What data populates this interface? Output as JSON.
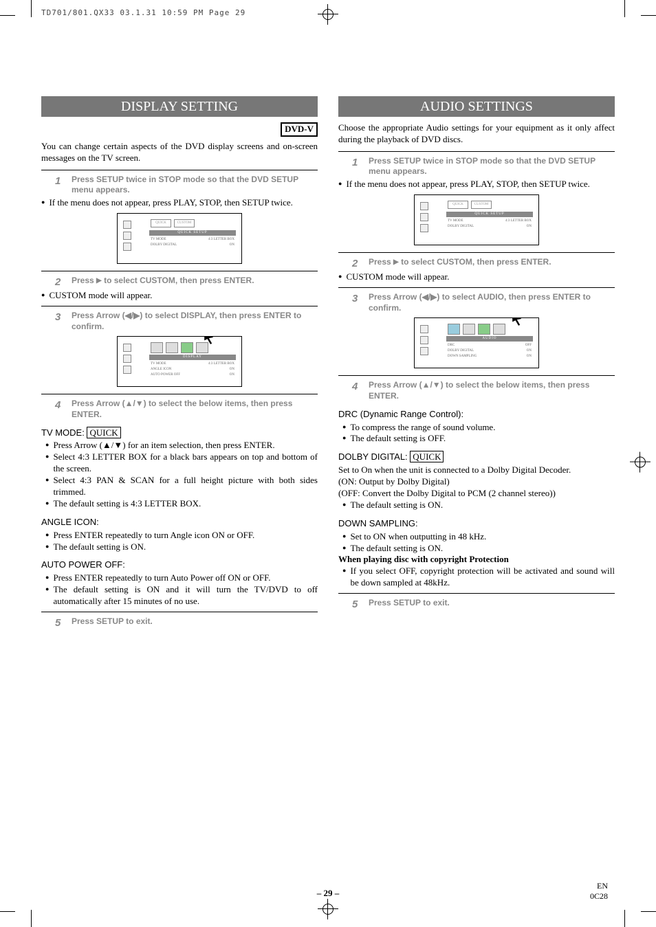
{
  "print_header": "TD701/801.QX33  03.1.31 10:59 PM  Page 29",
  "left": {
    "title": "DISPLAY SETTING",
    "badge": "DVD-V",
    "intro": "You can change certain aspects of the DVD display screens and on-screen messages on the TV screen.",
    "step1_num": "1",
    "step1": "Press SETUP twice in STOP mode so that the DVD SETUP menu appears.",
    "bullet1": "If the menu does not appear, press PLAY, STOP, then SETUP twice.",
    "screen1": {
      "tab1": "QUICK",
      "tab2": "CUSTOM",
      "bar": "QUICK SETUP",
      "row1a": "TV MODE",
      "row1b": "4:3 LETTER BOX",
      "row2a": "DOLBY DIGITAL",
      "row2b": "ON"
    },
    "step2_num": "2",
    "step2_a": "Press ",
    "step2_b": " to select CUSTOM, then press ENTER.",
    "bullet2": "CUSTOM mode will appear.",
    "step3_num": "3",
    "step3": "Press Arrow (◀/▶) to select DISPLAY, then press ENTER to confirm.",
    "screen2": {
      "bar": "DISPLAY",
      "row1a": "TV MODE",
      "row1b": "4:3 LETTER BOX",
      "row2a": "ANGLE ICON",
      "row2b": "ON",
      "row3a": "AUTO POWER OFF",
      "row3b": "ON"
    },
    "step4_num": "4",
    "step4": "Press Arrow (▲/▼) to select the below items, then press ENTER.",
    "tvmode_label": "TV MODE:",
    "tvmode_quick": "QUICK",
    "tvmode_b1": "Press Arrow (▲/▼) for an item selection, then press ENTER.",
    "tvmode_b2": "Select 4:3 LETTER BOX for a black bars appears on top and bottom of the screen.",
    "tvmode_b3": "Select 4:3 PAN & SCAN for a full height picture with both sides trimmed.",
    "tvmode_b4": "The default setting is 4:3 LETTER BOX.",
    "angle_label": "ANGLE ICON:",
    "angle_b1": "Press ENTER repeatedly to turn Angle icon ON or OFF.",
    "angle_b2": "The default setting is ON.",
    "apo_label": "AUTO POWER OFF:",
    "apo_b1": "Press ENTER repeatedly to turn Auto Power off ON or OFF.",
    "apo_b2": "The default setting is ON and it will turn the TV/DVD to off automatically after 15 minutes of no use.",
    "step5_num": "5",
    "step5": "Press SETUP to exit."
  },
  "right": {
    "title": "AUDIO SETTINGS",
    "intro": "Choose the appropriate Audio settings for your equipment as it only affect during the playback of DVD discs.",
    "step1_num": "1",
    "step1": "Press SETUP twice in STOP mode so that the DVD SETUP menu appears.",
    "bullet1": "If the menu does not appear, press PLAY, STOP, then SETUP twice.",
    "screen1": {
      "tab1": "QUICK",
      "tab2": "CUSTOM",
      "bar": "QUICK SETUP",
      "row1a": "TV MODE",
      "row1b": "4:3 LETTER BOX",
      "row2a": "DOLBY DIGITAL",
      "row2b": "ON"
    },
    "step2_num": "2",
    "step2_a": "Press ",
    "step2_b": " to select CUSTOM, then press ENTER.",
    "bullet2": "CUSTOM mode will appear.",
    "step3_num": "3",
    "step3": "Press Arrow (◀/▶) to select AUDIO, then press ENTER to confirm.",
    "screen2": {
      "bar": "AUDIO",
      "row1a": "DRC",
      "row1b": "OFF",
      "row2a": "DOLBY DIGITAL",
      "row2b": "ON",
      "row3a": "DOWN SAMPLING",
      "row3b": "ON"
    },
    "step4_num": "4",
    "step4": "Press Arrow (▲/▼) to select the below items, then press ENTER.",
    "drc_label": "DRC (Dynamic Range Control):",
    "drc_b1": "To compress the range of sound volume.",
    "drc_b2": "The default setting is OFF.",
    "dolby_label": "DOLBY DIGITAL:",
    "dolby_quick": "QUICK",
    "dolby_t1": "Set to On when the unit is connected to a Dolby Digital Decoder.",
    "dolby_t2": "(ON: Output by Dolby Digital)",
    "dolby_t3": "(OFF: Convert the Dolby Digital to PCM (2 channel stereo))",
    "dolby_b1": "The default setting is ON.",
    "ds_label": "DOWN SAMPLING:",
    "ds_b1": "Set to ON when outputting in 48 kHz.",
    "ds_b2": "The default setting is ON.",
    "ds_strong": "When playing disc with copyright Protection",
    "ds_b3": "If you select OFF, copyright protection will be activated and sound will be down sampled at 48kHz.",
    "step5_num": "5",
    "step5": "Press SETUP to exit."
  },
  "footer": {
    "page": "– 29 –",
    "lang": "EN",
    "code": "0C28"
  }
}
